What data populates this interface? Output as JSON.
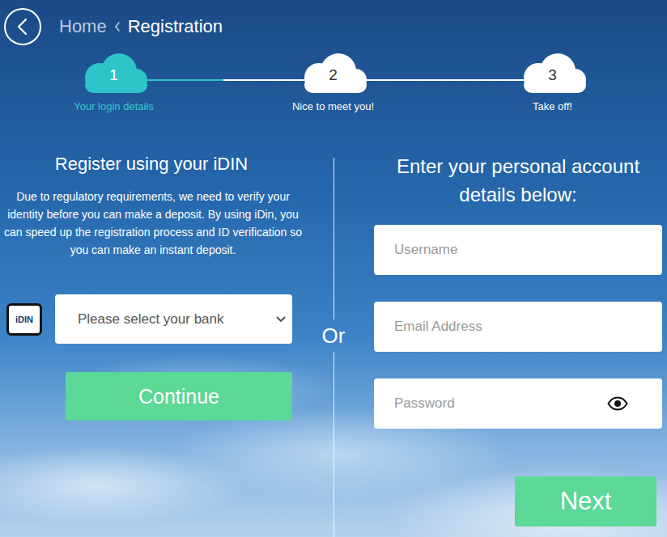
{
  "breadcrumb": {
    "items": [
      {
        "label": "Home",
        "selected": false
      },
      {
        "label": "Registration",
        "selected": true
      }
    ]
  },
  "stepper": {
    "level": 0.25,
    "steps": [
      {
        "number": "1",
        "label": "Your login details",
        "selected": true
      },
      {
        "number": "2",
        "label": "Nice to meet you!",
        "selected": false
      },
      {
        "number": "3",
        "label": "Take off!",
        "selected": false
      }
    ]
  },
  "idin_panel": {
    "title": "Register using your iDIN",
    "description": "Due to regulatory requirements, we need to verify your identity before you can make a deposit. By using iDin, you can speed up the registration process and ID verification so you can make an instant deposit.",
    "logo_text": "iDIN",
    "bank_select": {
      "placeholder": "Please select your bank"
    },
    "button": "Continue"
  },
  "divider": "Or",
  "account_panel": {
    "title": "Enter your personal account details below:",
    "fields": [
      {
        "placeholder": "Username",
        "kind": "text"
      },
      {
        "placeholder": "Email Address",
        "kind": "email"
      },
      {
        "placeholder": "Password",
        "kind": "password"
      }
    ],
    "button": "Next"
  }
}
